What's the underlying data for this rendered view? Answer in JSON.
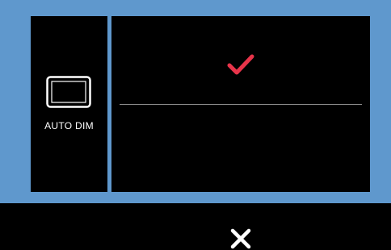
{
  "auto_dim": {
    "label": "AUTO DIM",
    "icon": "tablet-icon"
  },
  "confirm": {
    "icon": "checkmark-icon",
    "color": "#e8344a"
  },
  "cancel": {
    "icon": "close-icon",
    "color": "#ffffff"
  },
  "colors": {
    "frame": "#5f98cd",
    "panel": "#000000",
    "divider": "#8a8a8a"
  }
}
